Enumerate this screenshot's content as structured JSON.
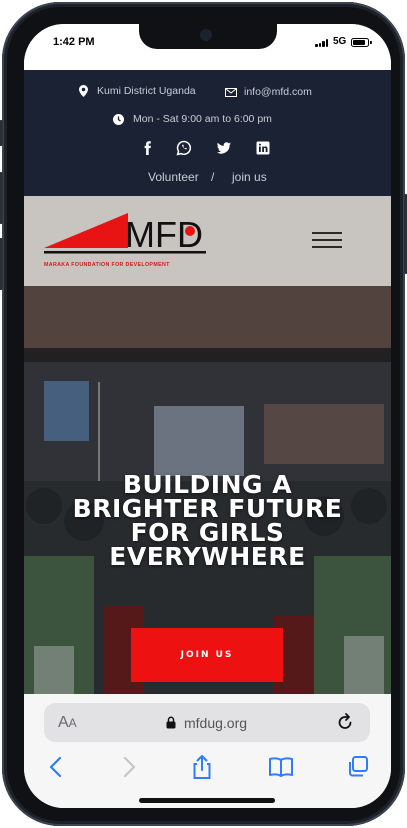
{
  "status_bar": {
    "time": "1:42 PM",
    "network": "5G",
    "battery_level": 0.85
  },
  "topbar": {
    "location": "Kumi District Uganda",
    "email": "info@mfd.com",
    "hours": "Mon - Sat 9:00 am to 6:00 pm",
    "social_icons": [
      "facebook-icon",
      "whatsapp-icon",
      "twitter-icon",
      "linkedin-icon"
    ],
    "links": {
      "volunteer": "Volunteer",
      "separator": "/",
      "join": "join us"
    }
  },
  "header": {
    "logo_text": "MFD",
    "logo_tagline": "MARAKA FOUNDATION FOR DEVELOPMENT"
  },
  "hero": {
    "title_lines": [
      "BUILDING A",
      "BRIGHTER FUTURE",
      "FOR GIRLS",
      "EVERYWHERE"
    ],
    "cta": "JOIN US"
  },
  "browser": {
    "text_size_label": "AA",
    "url": "mfdug.org",
    "toolbar_icons": [
      "back-icon",
      "forward-icon",
      "share-icon",
      "bookmarks-icon",
      "tabs-icon"
    ]
  },
  "colors": {
    "topbar_bg": "#1b2234",
    "header_bg": "#c8c4c0",
    "accent_red": "#ee1111",
    "dark": "#0f1115"
  }
}
